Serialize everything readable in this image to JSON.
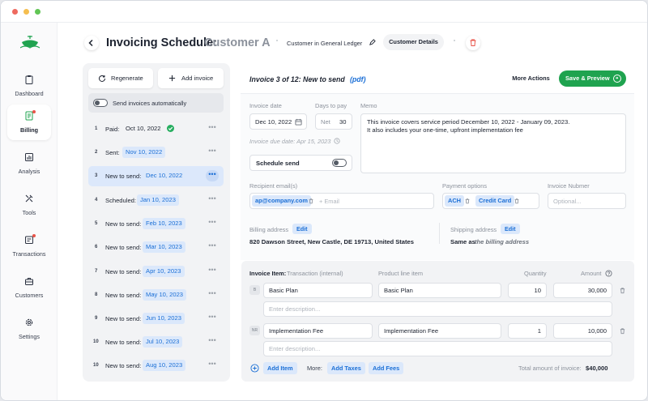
{
  "header": {
    "title": "Invoicing Schedule:",
    "customer": "Customer A",
    "ledger_link": "Customer in General Ledger",
    "details_tab": "Customer Details"
  },
  "sidebar": {
    "items": [
      {
        "label": "Dashboard",
        "icon": "clipboard-icon"
      },
      {
        "label": "Billing",
        "icon": "receipt-icon"
      },
      {
        "label": "Analysis",
        "icon": "bar-chart-icon"
      },
      {
        "label": "Tools",
        "icon": "tools-icon"
      },
      {
        "label": "Transactions",
        "icon": "transactions-icon"
      },
      {
        "label": "Customers",
        "icon": "briefcase-icon"
      },
      {
        "label": "Settings",
        "icon": "gear-icon"
      }
    ]
  },
  "schedule": {
    "regenerate_label": "Regenerate",
    "add_invoice_label": "Add invoice",
    "auto_send_label": "Send invoices automatically",
    "rows": [
      {
        "n": "1",
        "status": "Paid:",
        "date": "Oct 10, 2022"
      },
      {
        "n": "2",
        "status": "Sent:",
        "date": "Nov 10, 2022"
      },
      {
        "n": "3",
        "status": "New to send:",
        "date": "Dec 10, 2022"
      },
      {
        "n": "4",
        "status": "Scheduled:",
        "date": "Jan 10, 2023"
      },
      {
        "n": "5",
        "status": "New to send:",
        "date": "Feb 10, 2023"
      },
      {
        "n": "6",
        "status": "New to send:",
        "date": "Mar 10, 2023"
      },
      {
        "n": "7",
        "status": "New to send:",
        "date": "Apr 10, 2023"
      },
      {
        "n": "8",
        "status": "New to send:",
        "date": "May 10, 2023"
      },
      {
        "n": "9",
        "status": "New to send:",
        "date": "Jun 10, 2023"
      },
      {
        "n": "10",
        "status": "New to send:",
        "date": "Jul 10, 2023"
      },
      {
        "n": "10",
        "status": "New to send:",
        "date": "Aug 10, 2023"
      }
    ]
  },
  "invoice": {
    "title": "Invoice 3 of 12:  New to send",
    "pdf_label": "(pdf)",
    "more_actions": "More Actions",
    "save_preview": "Save & Preview",
    "invoice_date_label": "Invoice date",
    "invoice_date": "Dec 10, 2022",
    "days_to_pay_label": "Days to pay",
    "net_label": "Net",
    "net_value": "30",
    "due_date": "Invoice due date: Apr 15, 2023",
    "memo_label": "Memo",
    "memo_line1": "This invoice covers service period December 10, 2022 -  January 09, 2023.",
    "memo_line2": "It also includes your one-time, upfront implementation fee",
    "schedule_send": "Schedule send",
    "recipient_label": "Recipient email(s)",
    "recipient_chip": "ap@company.com",
    "recipient_placeholder": "+ Email",
    "payment_label": "Payment options",
    "payment_ach": "ACH",
    "payment_card": "Credit Card",
    "invoice_number_label": "Invoice Nubmer",
    "invoice_number_placeholder": "Optional...",
    "billing_label": "Billing address",
    "billing_edit": "Edit",
    "billing_address": "820 Dawson Street, New Castle, DE 19713, United States",
    "shipping_label": "Shipping address",
    "shipping_edit": "Edit",
    "shipping_same": "Same as",
    "shipping_ref": "the billing address"
  },
  "items": {
    "h_item": "Invoice Item:",
    "h_txn": "Transaction (internal)",
    "h_product": "Product line item",
    "h_qty": "Quantity",
    "h_amount": "Amount",
    "lines": [
      {
        "badge": "B",
        "txn": "Basic Plan",
        "product": "Basic Plan",
        "qty": "10",
        "amount": "30,000",
        "desc_placeholder": "Enter description..."
      },
      {
        "badge": "NR",
        "txn": "Implementation Fee",
        "product": "Implementation Fee",
        "qty": "1",
        "amount": "10,000",
        "desc_placeholder": "Enter description..."
      }
    ],
    "add_item": "Add Item",
    "more_label": "More:",
    "add_taxes": "Add Taxes",
    "add_fees": "Add Fees",
    "total_label": "Total amount of invoice:",
    "total_value": "$40,000"
  },
  "colors": {
    "accent": "#1b6fd6",
    "primary_green": "#1fa34f",
    "danger": "#e8554a"
  }
}
